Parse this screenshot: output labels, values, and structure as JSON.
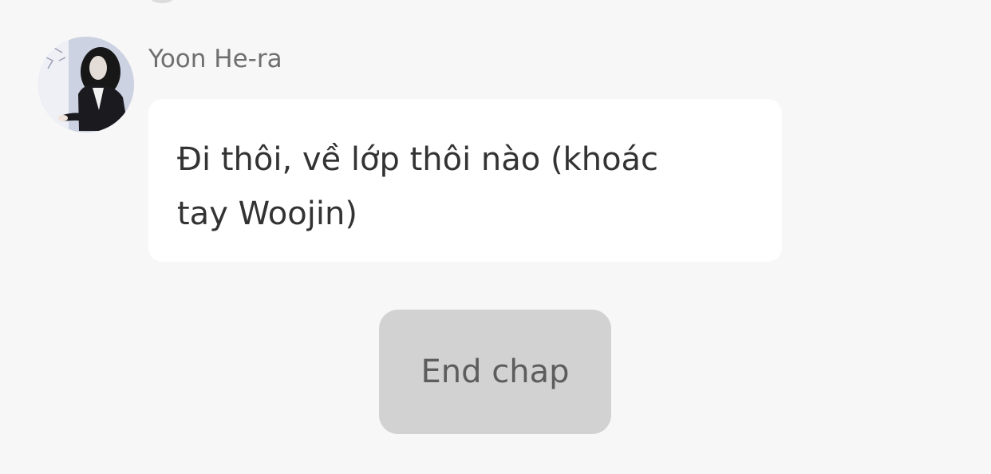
{
  "message": {
    "sender_name": "Yoon He-ra",
    "avatar_icon": "profile-photo",
    "text": "Đi thôi, về lớp thôi nào (khoác tay Woojin)"
  },
  "actions": {
    "end_chap_label": "End chap"
  },
  "colors": {
    "background": "#f7f7f7",
    "bubble": "#ffffff",
    "button": "#d2d2d2",
    "name_text": "#6f6f6f",
    "message_text": "#333333"
  }
}
